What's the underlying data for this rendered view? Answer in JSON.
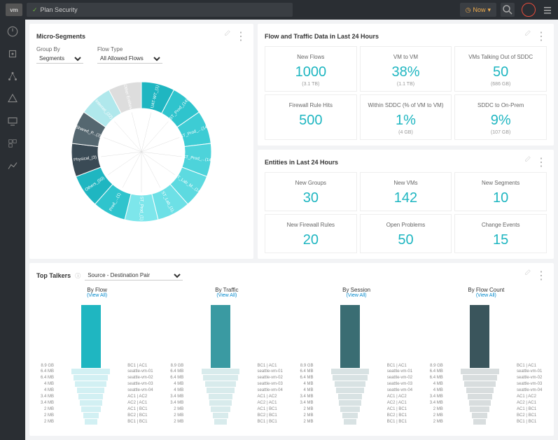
{
  "topbar": {
    "logo": "vm",
    "title": "Plan Security",
    "now": "Now"
  },
  "micro": {
    "title": "Micro-Segments",
    "groupby_label": "Group By",
    "groupby_value": "Segments",
    "flowtype_label": "Flow Type",
    "flowtype_value": "All Allowed Flows"
  },
  "flows": {
    "title": "Flow and Traffic Data in Last 24 Hours",
    "items": [
      {
        "label": "New Flows",
        "value": "1000",
        "sub": "(3.1 TB)"
      },
      {
        "label": "VM to VM",
        "value": "38%",
        "sub": "(1.1 TB)"
      },
      {
        "label": "VMs Talking Out of SDDC",
        "value": "50",
        "sub": "(686 GB)"
      },
      {
        "label": "Firewall Rule Hits",
        "value": "500",
        "sub": ""
      },
      {
        "label": "Within SDDC (% of VM to VM)",
        "value": "1%",
        "sub": "(4 GB)"
      },
      {
        "label": "SDDC to On-Prem",
        "value": "9%",
        "sub": "(107 GB)"
      }
    ]
  },
  "entities": {
    "title": "Entities in Last 24 Hours",
    "items": [
      {
        "label": "New Groups",
        "value": "30"
      },
      {
        "label": "New VMs",
        "value": "142"
      },
      {
        "label": "New Segments",
        "value": "10"
      },
      {
        "label": "New Firewall Rules",
        "value": "20"
      },
      {
        "label": "Open Problems",
        "value": "50"
      },
      {
        "label": "Change Events",
        "value": "15"
      }
    ]
  },
  "chart_data": {
    "type": "pie",
    "title": "Micro-Segments",
    "slices": [
      {
        "name": "UAT-WT_(1)",
        "color": "#1fb6c1"
      },
      {
        "name": "ST_Prod_(14)",
        "color": "#2fc4cd"
      },
      {
        "name": "ST_Prod_...(14)",
        "color": "#3dccd4"
      },
      {
        "name": "ST_Prod_...(14)",
        "color": "#4dd3da"
      },
      {
        "name": "ST_Lab_M...(14)",
        "color": "#5ddae0"
      },
      {
        "name": "ST_Lab_(1).",
        "color": "#6de0e6"
      },
      {
        "name": "ST_Prod_(1)",
        "color": "#7de6eb"
      },
      {
        "name": "Prod_...(1)",
        "color": "#2fc4cd"
      },
      {
        "name": "Others_(50)",
        "color": "#1fb6c1"
      },
      {
        "name": "Physical_(3)",
        "color": "#3a4a55"
      },
      {
        "name": "Shared_P...(3)",
        "color": "#556770"
      },
      {
        "name": "Internet_(22)",
        "color": "#b0e8ec"
      },
      {
        "name": "Other Entities",
        "color": "#ddd"
      }
    ]
  },
  "toptalkers": {
    "title": "Top Talkers",
    "help": "ⓘ",
    "dropdown": "Source - Destination Pair",
    "cols": [
      {
        "title": "By Flow",
        "link": "(View All)",
        "color": "#1fb6c1"
      },
      {
        "title": "By Traffic",
        "link": "(View All)",
        "color": "#3a9aa2"
      },
      {
        "title": "By Session",
        "link": "(View All)",
        "color": "#3a6d73"
      },
      {
        "title": "By Flow Count",
        "link": "(View All)",
        "color": "#3a555c"
      }
    ],
    "rows": [
      {
        "left": "8.9 GB",
        "right": "BC1 | AC1",
        "h": 90,
        "top": true
      },
      {
        "left": "6.4 MB",
        "right": "seattle-vm-01",
        "h": 8,
        "w": 0.55
      },
      {
        "left": "6.4 MB",
        "right": "seattle-vm-02",
        "h": 8,
        "w": 0.5
      },
      {
        "left": "4 MB",
        "right": "seattle-vm-03",
        "h": 8,
        "w": 0.45
      },
      {
        "left": "4 MB",
        "right": "seattle-vm-04",
        "h": 8,
        "w": 0.4
      },
      {
        "left": "3.4 MB",
        "right": "AC1 | AC2",
        "h": 8,
        "w": 0.35
      },
      {
        "left": "3.4 MB",
        "right": "AC2 | AC1",
        "h": 8,
        "w": 0.32
      },
      {
        "left": "2 MB",
        "right": "AC1 | BC1",
        "h": 8,
        "w": 0.28
      },
      {
        "left": "2 MB",
        "right": "BC2 | BC1",
        "h": 8,
        "w": 0.22
      },
      {
        "left": "2 MB",
        "right": "BC1 | BC1",
        "h": 8,
        "w": 0.18
      }
    ]
  }
}
